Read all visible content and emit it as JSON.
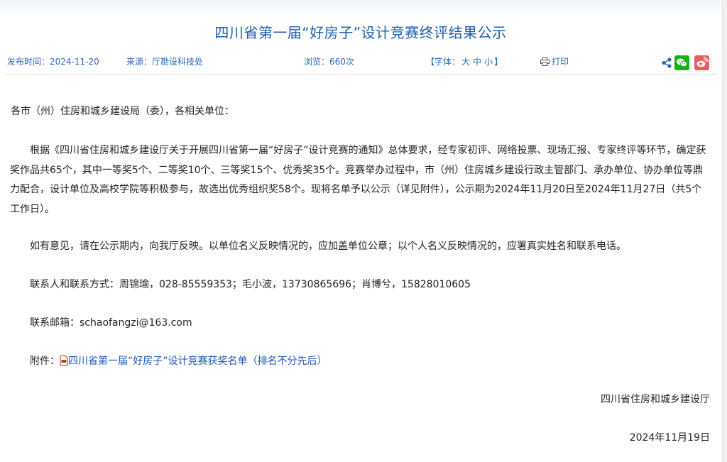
{
  "article": {
    "title": "四川省第一届“好房子”设计竞赛终评结果公示",
    "meta": {
      "publish_time": "发布时间：2024-11-20",
      "source": "来源：厅勘设科技处",
      "views": "浏览：660次",
      "font_prefix": "【字体：",
      "font_large": "大",
      "font_medium": "中",
      "font_small": "小",
      "font_suffix": "】",
      "print_label": "打印"
    },
    "greeting": "各市（州）住房和城乡建设局（委），各相关单位：",
    "paragraph1": "根据《四川省住房和城乡建设厅关于开展四川省第一届“好房子”设计竞赛的通知》总体要求，经专家初评、网络投票、现场汇报、专家终评等环节，确定获奖作品共65个，其中一等奖5个、二等奖10个、三等奖15个、优秀奖35个。竞赛举办过程中，市（州）住房城乡建设行政主管部门、承办单位、协办单位等鼎力配合，设计单位及高校学院等积极参与，故选出优秀组织奖58个。现将名单予以公示（详见附件），公示期为2024年11月20日至2024年11月27日（共5个工作日）。",
    "paragraph2": "如有意见，请在公示期内，向我厅反映。以单位名义反映情况的，应加盖单位公章；以个人名义反映情况的，应署真实姓名和联系电话。",
    "contact": "联系人和联系方式：周锦瑜，028-85559353；毛小波，13730865696；肖博兮，15828010605",
    "email": "联系邮箱：schaofangzi@163.com",
    "attachment_label": "附件：",
    "attachment_link": "四川省第一届“好房子”设计竞赛获奖名单（排名不分先后）",
    "signature": "四川省住房和城乡建设厅",
    "sign_date": "2024年11月19日"
  },
  "icons": {
    "print": "printer-icon",
    "share": "share-icon",
    "wechat": "wechat-icon",
    "weibo": "weibo-icon",
    "attachment": "pdf-file-icon"
  },
  "colors": {
    "title": "#1f5fb0",
    "meta": "#2a67b8",
    "link": "#1f57b8",
    "wechat": "#16b116",
    "weibo": "#ea5b5b"
  }
}
